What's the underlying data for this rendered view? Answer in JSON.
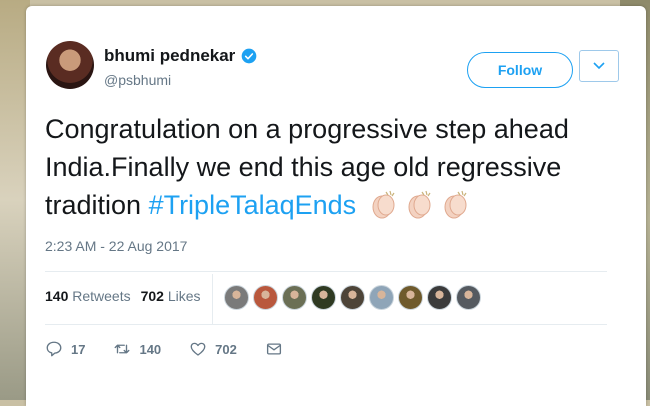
{
  "user": {
    "name": "bhumi pednekar",
    "handle": "@psbhumi",
    "verified": true
  },
  "follow_button": "Follow",
  "tweet": {
    "line1": "Congratulation on a progressive step ahead",
    "line2": "India.Finally we end this age old regressive",
    "line3": "tradition ",
    "hashtag": "#TripleTalaqEnds",
    "emoji": "clapping-hands-icon x3"
  },
  "timestamp": "2:23 AM - 22 Aug 2017",
  "stats": {
    "retweets_count": "140",
    "retweets_label": "Retweets",
    "likes_count": "702",
    "likes_label": "Likes"
  },
  "likers": [
    "#7a7a7a",
    "#b9583d",
    "#6b6f55",
    "#2f3a22",
    "#4d4438",
    "#8fa5b8",
    "#6f5a2c",
    "#3b3b3b",
    "#555a60"
  ],
  "actions": {
    "reply_count": "17",
    "retweet_count": "140",
    "like_count": "702"
  },
  "colors": {
    "accent": "#1da1f2",
    "secondary_text": "#657786",
    "primary_text": "#14171a"
  }
}
